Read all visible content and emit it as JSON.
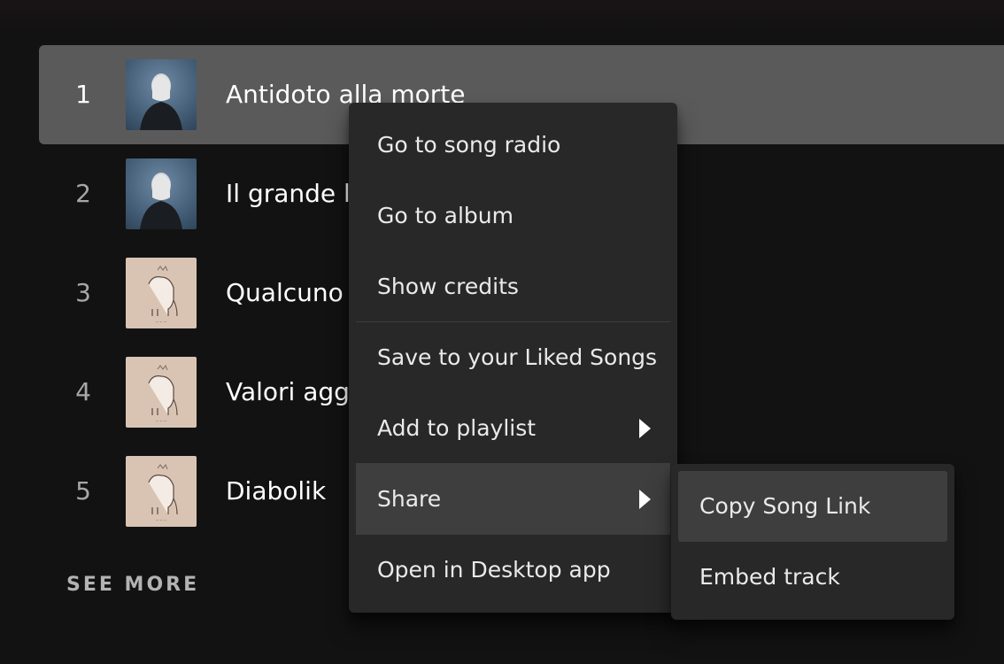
{
  "tracks": [
    {
      "number": "1",
      "title": "Antidoto alla morte",
      "cover": "dark-portrait-cover"
    },
    {
      "number": "2",
      "title": "Il grande l",
      "cover": "dark-portrait-cover"
    },
    {
      "number": "3",
      "title": "Qualcuno",
      "cover": "unicorn-cover"
    },
    {
      "number": "4",
      "title": "Valori agg",
      "cover": "unicorn-cover"
    },
    {
      "number": "5",
      "title": "Diabolik",
      "cover": "unicorn-cover"
    }
  ],
  "see_more_label": "SEE MORE",
  "context_menu": {
    "items": [
      {
        "label": "Go to song radio"
      },
      {
        "label": "Go to album"
      },
      {
        "label": "Show credits"
      },
      {
        "label": "Save to your Liked Songs"
      },
      {
        "label": "Add to playlist",
        "icon": "caret-right-icon"
      },
      {
        "label": "Share",
        "icon": "caret-right-icon"
      },
      {
        "label": "Open in Desktop app"
      }
    ]
  },
  "share_submenu": {
    "items": [
      {
        "label": "Copy Song Link"
      },
      {
        "label": "Embed track"
      }
    ]
  },
  "colors": {
    "background": "#121212",
    "active_row": "#5b5a5a",
    "menu_bg": "#282828",
    "menu_highlight": "#3e3e3e",
    "text_primary": "#ffffff",
    "text_muted": "#a7a7a7"
  }
}
